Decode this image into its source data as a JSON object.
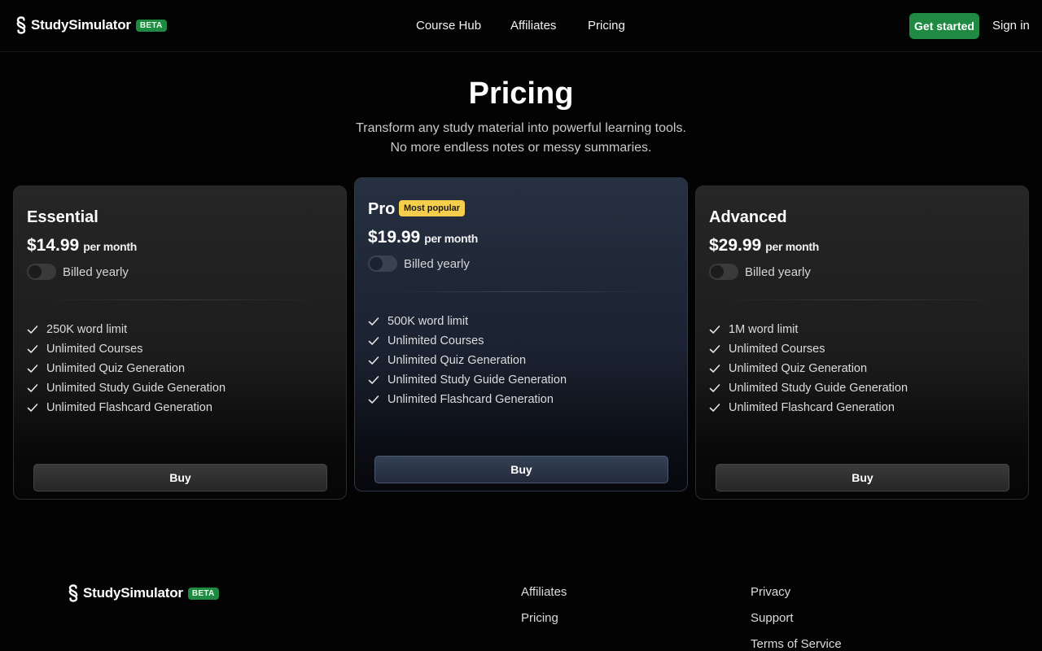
{
  "brand": {
    "name": "StudySimulator",
    "badge": "BETA",
    "accent_color": "#1f8a42"
  },
  "nav": {
    "links": [
      "Course Hub",
      "Affiliates",
      "Pricing"
    ],
    "get_started": "Get started",
    "sign_in": "Sign in"
  },
  "hero": {
    "title": "Pricing",
    "subtitle": "Transform any study material into powerful learning tools. No more endless notes or messy summaries."
  },
  "plans": [
    {
      "name": "Essential",
      "price": "$14.99",
      "period": "per month",
      "billing_label": "Billed yearly",
      "billed_yearly_on": false,
      "features": [
        "250K word limit",
        "Unlimited Courses",
        "Unlimited Quiz Generation",
        "Unlimited Study Guide Generation",
        "Unlimited Flashcard Generation"
      ],
      "button": "Buy"
    },
    {
      "name": "Pro",
      "badge": "Most popular",
      "price": "$19.99",
      "period": "per month",
      "billing_label": "Billed yearly",
      "billed_yearly_on": false,
      "features": [
        "500K word limit",
        "Unlimited Courses",
        "Unlimited Quiz Generation",
        "Unlimited Study Guide Generation",
        "Unlimited Flashcard Generation"
      ],
      "button": "Buy"
    },
    {
      "name": "Advanced",
      "price": "$29.99",
      "period": "per month",
      "billing_label": "Billed yearly",
      "billed_yearly_on": false,
      "features": [
        "1M word limit",
        "Unlimited Courses",
        "Unlimited Quiz Generation",
        "Unlimited Study Guide Generation",
        "Unlimited Flashcard Generation"
      ],
      "button": "Buy"
    }
  ],
  "footer": {
    "col1": [
      "Affiliates",
      "Pricing"
    ],
    "col2": [
      "Privacy",
      "Support",
      "Terms of Service"
    ]
  },
  "icons": {
    "logo": "s-link-logo-icon",
    "check": "check-icon"
  }
}
